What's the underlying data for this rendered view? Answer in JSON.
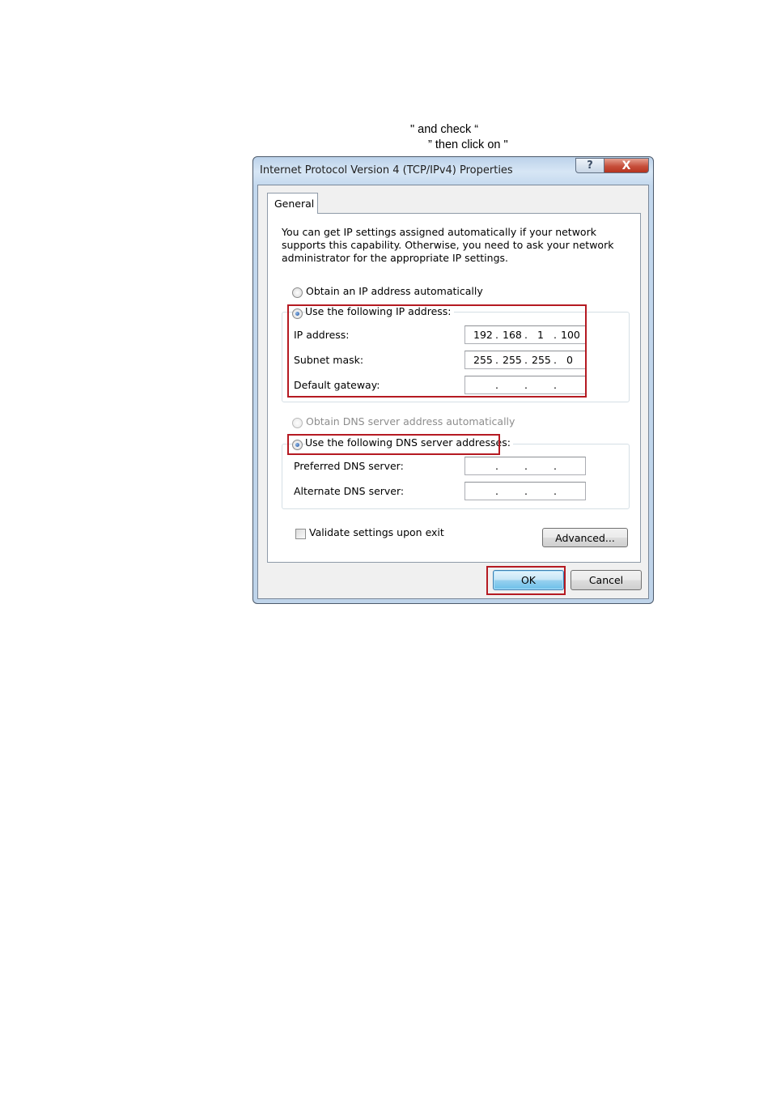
{
  "instructions": {
    "line1": "\" and check “",
    "line2": "” then click on \""
  },
  "dialog": {
    "title": "Internet Protocol Version 4 (TCP/IPv4) Properties",
    "help_glyph": "?",
    "close_glyph": "X",
    "tabs": [
      {
        "label": "General"
      }
    ],
    "description": "You can get IP settings assigned automatically if your network supports this capability. Otherwise, you need to ask your network administrator for the appropriate IP settings.",
    "ip_section": {
      "auto_label": "Obtain an IP address automatically",
      "manual_label": "Use the following IP address:",
      "selected": "manual",
      "fields": [
        {
          "label": "IP address:",
          "octets": [
            "192",
            "168",
            "1",
            "100"
          ]
        },
        {
          "label": "Subnet mask:",
          "octets": [
            "255",
            "255",
            "255",
            "0"
          ]
        },
        {
          "label": "Default gateway:",
          "octets": [
            "",
            "",
            "",
            ""
          ]
        }
      ]
    },
    "dns_section": {
      "auto_label": "Obtain DNS server address automatically",
      "manual_label": "Use the following DNS server addresses:",
      "selected": "manual",
      "auto_enabled": false,
      "fields": [
        {
          "label": "Preferred DNS server:",
          "octets": [
            "",
            "",
            "",
            ""
          ]
        },
        {
          "label": "Alternate DNS server:",
          "octets": [
            "",
            "",
            "",
            ""
          ]
        }
      ]
    },
    "validate_label": "Validate settings upon exit",
    "validate_checked": false,
    "advanced_label": "Advanced...",
    "ok_label": "OK",
    "cancel_label": "Cancel",
    "highlight_color": "#b51a22"
  }
}
